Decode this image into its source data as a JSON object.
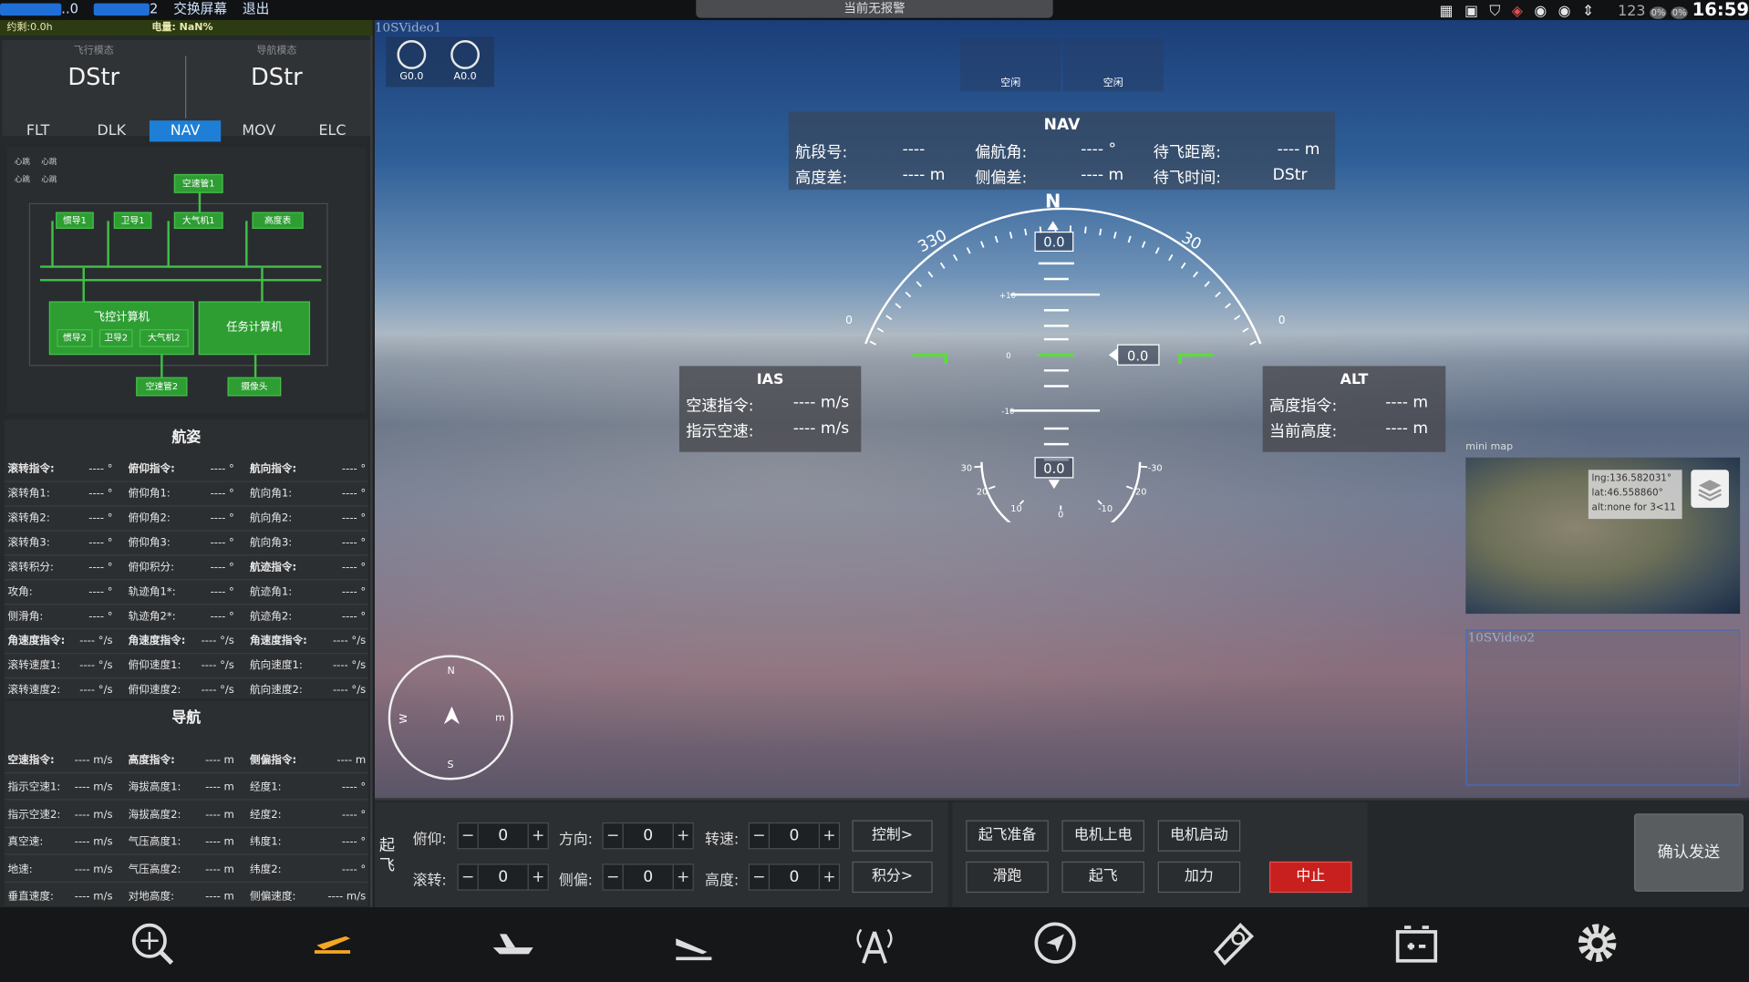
{
  "topbar": {
    "left_partial_1": "..0",
    "left_partial_2": "2",
    "switch_screen": "交换屏幕",
    "exit": "退出",
    "alarm": "当前无报警",
    "num": "123",
    "pct1": "0%",
    "pct2": "0%",
    "clock": "16:59"
  },
  "status": {
    "flight_time": "约剩:0.0h",
    "power": "电量: NaN%"
  },
  "modes": {
    "flight_label": "飞行模态",
    "flight_value": "DStr",
    "nav_label": "导航模态",
    "nav_value": "DStr"
  },
  "tabs": [
    "FLT",
    "DLK",
    "NAV",
    "MOV",
    "ELC"
  ],
  "active_tab": "NAV",
  "diagram": {
    "heartbeats": [
      "心跳",
      "心跳",
      "心跳",
      "心跳"
    ],
    "airspeed1": "空速管1",
    "ins1": "惯导1",
    "gnss1": "卫导1",
    "adc1": "大气机1",
    "altimeter": "高度表",
    "fcc": "飞控计算机",
    "ins2": "惯导2",
    "gnss2": "卫导2",
    "adc2": "大气机2",
    "mission": "任务计算机",
    "airspeed2": "空速管2",
    "camera": "摄像头"
  },
  "attitude": {
    "title": "航姿",
    "rows": [
      [
        {
          "l": "滚转指令:",
          "v": "---- °",
          "b": true
        },
        {
          "l": "俯仰指令:",
          "v": "---- °",
          "b": true
        },
        {
          "l": "航向指令:",
          "v": "---- °",
          "b": true
        }
      ],
      [
        {
          "l": "滚转角1:",
          "v": "---- °"
        },
        {
          "l": "俯仰角1:",
          "v": "---- °"
        },
        {
          "l": "航向角1:",
          "v": "---- °"
        }
      ],
      [
        {
          "l": "滚转角2:",
          "v": "---- °"
        },
        {
          "l": "俯仰角2:",
          "v": "---- °"
        },
        {
          "l": "航向角2:",
          "v": "---- °"
        }
      ],
      [
        {
          "l": "滚转角3:",
          "v": "---- °"
        },
        {
          "l": "俯仰角3:",
          "v": "---- °"
        },
        {
          "l": "航向角3:",
          "v": "---- °"
        }
      ],
      [
        {
          "l": "滚转积分:",
          "v": "---- °"
        },
        {
          "l": "俯仰积分:",
          "v": "---- °"
        },
        {
          "l": "航迹指令:",
          "v": "---- °",
          "b": true
        }
      ],
      [
        {
          "l": "攻角:",
          "v": "---- °"
        },
        {
          "l": "轨迹角1*:",
          "v": "---- °"
        },
        {
          "l": "航迹角1:",
          "v": "---- °"
        }
      ],
      [
        {
          "l": "侧滑角:",
          "v": "---- °"
        },
        {
          "l": "轨迹角2*:",
          "v": "---- °"
        },
        {
          "l": "航迹角2:",
          "v": "---- °"
        }
      ],
      [
        {
          "l": "角速度指令:",
          "v": "---- °/s",
          "b": true
        },
        {
          "l": "角速度指令:",
          "v": "---- °/s",
          "b": true
        },
        {
          "l": "角速度指令:",
          "v": "---- °/s",
          "b": true
        }
      ],
      [
        {
          "l": "滚转速度1:",
          "v": "---- °/s"
        },
        {
          "l": "俯仰速度1:",
          "v": "---- °/s"
        },
        {
          "l": "航向速度1:",
          "v": "---- °/s"
        }
      ],
      [
        {
          "l": "滚转速度2:",
          "v": "---- °/s"
        },
        {
          "l": "俯仰速度2:",
          "v": "---- °/s"
        },
        {
          "l": "航向速度2:",
          "v": "---- °/s"
        }
      ]
    ]
  },
  "navigation": {
    "title": "导航",
    "rows": [
      [
        {
          "l": "空速指令:",
          "v": "---- m/s",
          "b": true
        },
        {
          "l": "高度指令:",
          "v": "---- m",
          "b": true
        },
        {
          "l": "侧偏指令:",
          "v": "---- m",
          "b": true
        }
      ],
      [
        {
          "l": "指示空速1:",
          "v": "---- m/s"
        },
        {
          "l": "海拔高度1:",
          "v": "---- m"
        },
        {
          "l": "经度1:",
          "v": "---- °"
        }
      ],
      [
        {
          "l": "指示空速2:",
          "v": "---- m/s"
        },
        {
          "l": "海拔高度2:",
          "v": "---- m"
        },
        {
          "l": "经度2:",
          "v": "---- °"
        }
      ],
      [
        {
          "l": "真空速:",
          "v": "---- m/s"
        },
        {
          "l": "气压高度1:",
          "v": "---- m"
        },
        {
          "l": "纬度1:",
          "v": "---- °"
        }
      ],
      [
        {
          "l": "地速:",
          "v": "---- m/s"
        },
        {
          "l": "气压高度2:",
          "v": "---- m"
        },
        {
          "l": "纬度2:",
          "v": "---- °"
        }
      ],
      [
        {
          "l": "垂直速度:",
          "v": "---- m/s"
        },
        {
          "l": "对地高度:",
          "v": "---- m"
        },
        {
          "l": "侧偏速度:",
          "v": "---- m/s"
        }
      ]
    ]
  },
  "video": {
    "label1": "10SVideo1",
    "label2": "10SVideo2",
    "g_label": "G0.0",
    "a_label": "A0.0",
    "idle1": "空闲",
    "idle2": "空闲"
  },
  "nav_panel": {
    "title": "NAV",
    "seg_label": "航段号:",
    "seg_value": "----",
    "yaw_label": "偏航角:",
    "yaw_value": "---- °",
    "dist_label": "待飞距离:",
    "dist_value": "---- m",
    "alt_label": "高度差:",
    "alt_value": "---- m",
    "side_label": "侧偏差:",
    "side_value": "---- m",
    "time_label": "待飞时间:",
    "time_value": "DStr"
  },
  "ias": {
    "title": "IAS",
    "cmd_label": "空速指令:",
    "cmd_value": "---- m/s",
    "ind_label": "指示空速:",
    "ind_value": "---- m/s"
  },
  "alt": {
    "title": "ALT",
    "cmd_label": "高度指令:",
    "cmd_value": "---- m",
    "cur_label": "当前高度:",
    "cur_value": "---- m"
  },
  "hud": {
    "north": "N",
    "heading_left": "330",
    "heading_right": "30",
    "heading_value": "0.0",
    "pitch_value": "0.0",
    "roll_value": "0.0",
    "pitch_p10": "+10",
    "pitch_0": "0",
    "pitch_m10": "-10",
    "roll_ticks": [
      "-30",
      "-20",
      "-10",
      "0",
      "10",
      "20",
      "30"
    ],
    "edge_left": "0",
    "edge_right": "0"
  },
  "minimap": {
    "label": "mini map",
    "lng": "lng:136.582031°",
    "lat": "lat:46.558860°",
    "alt": "alt:none for 3<11"
  },
  "compass": {
    "n": "N",
    "s": "S",
    "w": "W",
    "e": "m"
  },
  "control": {
    "takeoff": "起飞",
    "pitch_label": "俯仰:",
    "pitch_value": "0",
    "dir_label": "方向:",
    "dir_value": "0",
    "rpm_label": "转速:",
    "rpm_value": "0",
    "roll_label": "滚转:",
    "roll_value": "0",
    "yaw_label": "侧偏:",
    "yaw_value": "0",
    "height_label": "高度:",
    "height_value": "0",
    "minus": "−",
    "plus": "+",
    "control_btn": "控制>",
    "integral_btn": "积分>",
    "prep": "起飞准备",
    "motor_power": "电机上电",
    "motor_start": "电机启动",
    "taxi": "滑跑",
    "fly": "起飞",
    "throttle": "加力",
    "abort": "中止",
    "confirm": "确认发送"
  },
  "colors": {
    "accent": "#1f7fd6",
    "green": "#2e9e33",
    "abort": "#c8201e"
  }
}
